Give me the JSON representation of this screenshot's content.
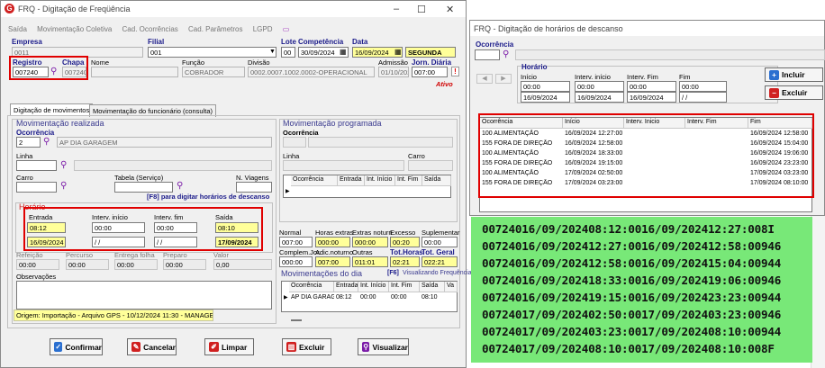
{
  "main": {
    "title": "FRQ - Digitação de Freqüência",
    "menu": [
      "Saída",
      "Movimentação Coletiva",
      "Cad. Ocorrências",
      "Cad. Parâmetros",
      "LGPD"
    ],
    "header": {
      "empresa_label": "Empresa",
      "empresa_value": "0011",
      "filial_label": "Filial",
      "filial_value": "001",
      "lote_label": "Lote",
      "lote_value": "00",
      "competencia_label": "Competência",
      "competencia_value": "30/09/2024",
      "data_label": "Data",
      "data_value": "16/09/2024",
      "weekday": "SEGUNDA",
      "registro_label": "Registro",
      "registro_value": "007240",
      "chapa_label": "Chapa",
      "chapa_value": "007240",
      "nome_label": "Nome",
      "funcao_label": "Função",
      "funcao_value": "COBRADOR",
      "divisao_label": "Divisão",
      "divisao_value": "0002.0007.1002.0002-OPERACIONAL",
      "admissao_label": "Admissão",
      "admissao_value": "01/10/2021",
      "jornada_label": "Jorn. Diária",
      "jornada_value": "007:00",
      "status": "Ativo"
    },
    "tabs": [
      "Digitação de movimentos",
      "Movimentação do funcionário (consulta)"
    ],
    "realizada": {
      "title": "Movimentação realizada",
      "ocorrencia_label": "Ocorrência",
      "ocorrencia_code": "2",
      "ocorrencia_desc": "AP DIA GARAGEM",
      "linha_label": "Linha",
      "carro_label": "Carro",
      "tabela_label": "Tabela (Serviço)",
      "viagens_label": "N. Viagens",
      "f8_hint": "[F8] para digitar horários de descanso"
    },
    "horario": {
      "title": "Horário",
      "entrada_label": "Entrada",
      "entrada_time": "08:12",
      "entrada_date": "16/09/2024",
      "int_inicio_label": "Interv. início",
      "int_inicio_time": "00:00",
      "int_inicio_date": "/ /",
      "int_fim_label": "Interv. fim",
      "int_fim_time": "00:00",
      "int_fim_date": "/ /",
      "saida_label": "Saída",
      "saida_time": "08:10",
      "saida_date": "17/09/2024"
    },
    "extras": {
      "refeicao_label": "Refeição",
      "refeicao_value": "00:00",
      "percurso_label": "Percurso",
      "percurso_value": "00:00",
      "entregafolha_label": "Entrega folha",
      "entregafolha_value": "00:00",
      "preparo_label": "Preparo",
      "preparo_value": "00:00",
      "valor_label": "Valor",
      "valor_value": "0,00",
      "observacoes_label": "Observações"
    },
    "origem": "Origem: Importação - Arquivo GPS - 10/12/2024 11:30 - MANAGER",
    "programada": {
      "title": "Movimentação programada",
      "ocorrencia_label": "Ocorrência",
      "linha_label": "Linha",
      "carro_label": "Carro",
      "columns": [
        "Ocorrência",
        "Entrada",
        "Int. Início",
        "Int. Fim",
        "Saída"
      ]
    },
    "totals": {
      "normal_label": "Normal",
      "normal_value": "007:00",
      "horasextras_label": "Horas extras",
      "horasextras_value": "000:00",
      "extrasnot_label": "Extras noturn.",
      "extrasnot_value": "000:00",
      "excesso_label": "Excesso",
      "excesso_value": "00:20",
      "suplementar_label": "Suplementar",
      "suplementar_value": "00:00",
      "complem_label": "Complem.Jor.",
      "complem_value": "000:00",
      "adicnot_label": "Adic.noturno",
      "adicnot_value": "007:00",
      "outras_label": "Outras",
      "outras_value": "011:01",
      "tothoras_label": "Tot.Horas",
      "tothoras_value": "02:21",
      "totgeral_label": "Tot. Geral",
      "totgeral_value": "022:21"
    },
    "movdia": {
      "title": "Movimentações do dia",
      "f6_label": "[F6]",
      "f6_hint": "Visualizando Frequência",
      "columns": [
        "Ocorrência",
        "Entrada",
        "Int. Início",
        "Int. Fim",
        "Saída",
        "Va"
      ],
      "row": [
        "AP DIA GARAG",
        "08:12",
        "00:00",
        "00:00",
        "08:10",
        ""
      ]
    },
    "buttons": [
      "Confirmar",
      "Cancelar",
      "Limpar",
      "Excluir",
      "Visualizar"
    ]
  },
  "descanso": {
    "title": "FRQ - Digitação de horários de descanso",
    "ocorrencia_label": "Ocorrência",
    "horario_label": "Horário",
    "inicio_label": "Início",
    "inicio_time": "00:00",
    "inicio_date": "16/09/2024",
    "int_inicio_label": "Interv. início",
    "int_inicio_time": "00:00",
    "int_inicio_date": "16/09/2024",
    "int_fim_label": "Interv. Fim",
    "int_fim_time": "00:00",
    "int_fim_date": "16/09/2024",
    "fim_label": "Fim",
    "fim_time": "00:00",
    "fim_date": "/ /",
    "incluir_label": "Incluir",
    "excluir_label": "Excluir",
    "columns": [
      "Ocorrência",
      "Início",
      "Interv. Inicio",
      "Interv. Fim",
      "Fim"
    ],
    "rows": [
      [
        "100 ALIMENTAÇÃO",
        "16/09/2024 12:27:00",
        "",
        "",
        "16/09/2024 12:58:00"
      ],
      [
        "155 FORA DE DIREÇÃO",
        "16/09/2024 12:58:00",
        "",
        "",
        "16/09/2024 15:04:00"
      ],
      [
        "100 ALIMENTAÇÃO",
        "16/09/2024 18:33:00",
        "",
        "",
        "16/09/2024 19:06:00"
      ],
      [
        "155 FORA DE DIREÇÃO",
        "16/09/2024 19:15:00",
        "",
        "",
        "16/09/2024 23:23:00"
      ],
      [
        "100 ALIMENTAÇÃO",
        "17/09/2024 02:50:00",
        "",
        "",
        "17/09/2024 03:23:00"
      ],
      [
        "155 FORA DE DIREÇÃO",
        "17/09/2024 03:23:00",
        "",
        "",
        "17/09/2024 08:10:00"
      ]
    ]
  },
  "gps_lines": [
    "00724016/09/202408:12:0016/09/202412:27:008I",
    "00724016/09/202412:27:0016/09/202412:58:00946",
    "00724016/09/202412:58:0016/09/202415:04:00944",
    "00724016/09/202418:33:0016/09/202419:06:00946",
    "00724016/09/202419:15:0016/09/202423:23:00944",
    "00724017/09/202402:50:0017/09/202403:23:00946",
    "00724017/09/202403:23:0017/09/202408:10:00944",
    "00724017/09/202408:10:0017/09/202408:10:008F"
  ],
  "colors": {
    "highlight_red": "#e00000",
    "yellow_field": "#ffff99",
    "green_panel": "#78e878",
    "section_blue": "#3a3a8f"
  }
}
